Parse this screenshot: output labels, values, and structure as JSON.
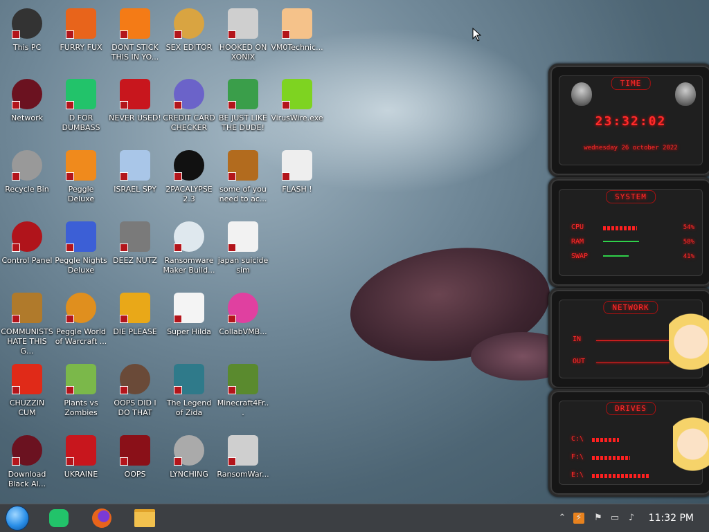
{
  "desktop": {
    "icons": [
      {
        "label": "This PC",
        "color": "#333"
      },
      {
        "label": "FURRY FUX",
        "color": "#e8641b"
      },
      {
        "label": "DONT STICK THIS IN YO...",
        "color": "#f47b16"
      },
      {
        "label": "SEX EDITOR",
        "color": "#d9a441"
      },
      {
        "label": "HOOKED ON XONIX",
        "color": "#cfcfcf"
      },
      {
        "label": "VM0Technic...",
        "color": "#f5c28a"
      },
      {
        "label": "Network",
        "color": "#6b1220"
      },
      {
        "label": "D FOR DUMBASS",
        "color": "#22c36a"
      },
      {
        "label": "NEVER USED!",
        "color": "#c8161d"
      },
      {
        "label": "CREDIT CARD CHECKER",
        "color": "#6b63c9"
      },
      {
        "label": "BE JUST LIKE THE DUDE!",
        "color": "#3a9e4a"
      },
      {
        "label": "VirusWire.exe",
        "color": "#7ed321"
      },
      {
        "label": "Recycle Bin",
        "color": "#999"
      },
      {
        "label": "Peggle Deluxe",
        "color": "#f08a1c"
      },
      {
        "label": "ISRAEL SPY",
        "color": "#a9c6e8"
      },
      {
        "label": "2PACALYPSE 2.3",
        "color": "#111"
      },
      {
        "label": "some of you need to ac...",
        "color": "#b26b1e"
      },
      {
        "label": "FLASH !",
        "color": "#eee"
      },
      {
        "label": "Control Panel",
        "color": "#b0141b"
      },
      {
        "label": "Peggle Nights Deluxe",
        "color": "#3c5fd6"
      },
      {
        "label": "DEEZ NUTZ",
        "color": "#7a7a7a"
      },
      {
        "label": "Ransomware Maker Build...",
        "color": "#dfe8ee"
      },
      {
        "label": "japan suicide sim",
        "color": "#f2f2f2"
      },
      {
        "label": "COMMUNISTS HATE THIS G...",
        "color": "#b07a2b"
      },
      {
        "label": "Peggle World of Warcraft ...",
        "color": "#e08f1e"
      },
      {
        "label": "DIE PLEASE",
        "color": "#e9a818"
      },
      {
        "label": "Super Hilda",
        "color": "#f4f4f4"
      },
      {
        "label": "CollabVMB...",
        "color": "#e040a0"
      },
      {
        "label": "CHUZZIN CUM",
        "color": "#e02a18"
      },
      {
        "label": "Plants vs Zombies",
        "color": "#7bb84a"
      },
      {
        "label": "OOPS DID I DO THAT",
        "color": "#6a4a38"
      },
      {
        "label": "The Legend of Zida",
        "color": "#2f7a8a"
      },
      {
        "label": "Minecraft4Fr...",
        "color": "#5a8a2e"
      },
      {
        "label": "Download Black Al...",
        "color": "#6b1220"
      },
      {
        "label": "UKRAINE",
        "color": "#c8161d"
      },
      {
        "label": "OOPS",
        "color": "#8a1018"
      },
      {
        "label": "LYNCHING",
        "color": "#aaa"
      },
      {
        "label": "RansomWar...",
        "color": "#cfcfcf"
      }
    ]
  },
  "widgets": {
    "time": {
      "title": "TIME",
      "clock": "23:32:02",
      "date": "wednesday 26 october 2022"
    },
    "system": {
      "title": "SYSTEM",
      "rows": [
        {
          "label": "CPU",
          "value": "54%",
          "level": 0.54
        },
        {
          "label": "RAM",
          "value": "58%",
          "level": 0.58
        },
        {
          "label": "SWAP",
          "value": "41%",
          "level": 0.41
        }
      ]
    },
    "network": {
      "title": "NETWORK",
      "in_label": "IN",
      "out_label": "OUT"
    },
    "drives": {
      "title": "DRIVES",
      "rows": [
        {
          "label": "C:\\",
          "level": 0.35
        },
        {
          "label": "F:\\",
          "level": 0.5
        },
        {
          "label": "E:\\",
          "level": 0.75
        }
      ]
    }
  },
  "taskbar": {
    "clock": "11:32 PM",
    "items": [
      {
        "name": "start-orb",
        "color": "#2a8fe8"
      },
      {
        "name": "green-app",
        "color": "#22c36a"
      },
      {
        "name": "firefox",
        "color": "#e8641b"
      },
      {
        "name": "file-explorer",
        "color": "#f2c14e"
      }
    ]
  }
}
